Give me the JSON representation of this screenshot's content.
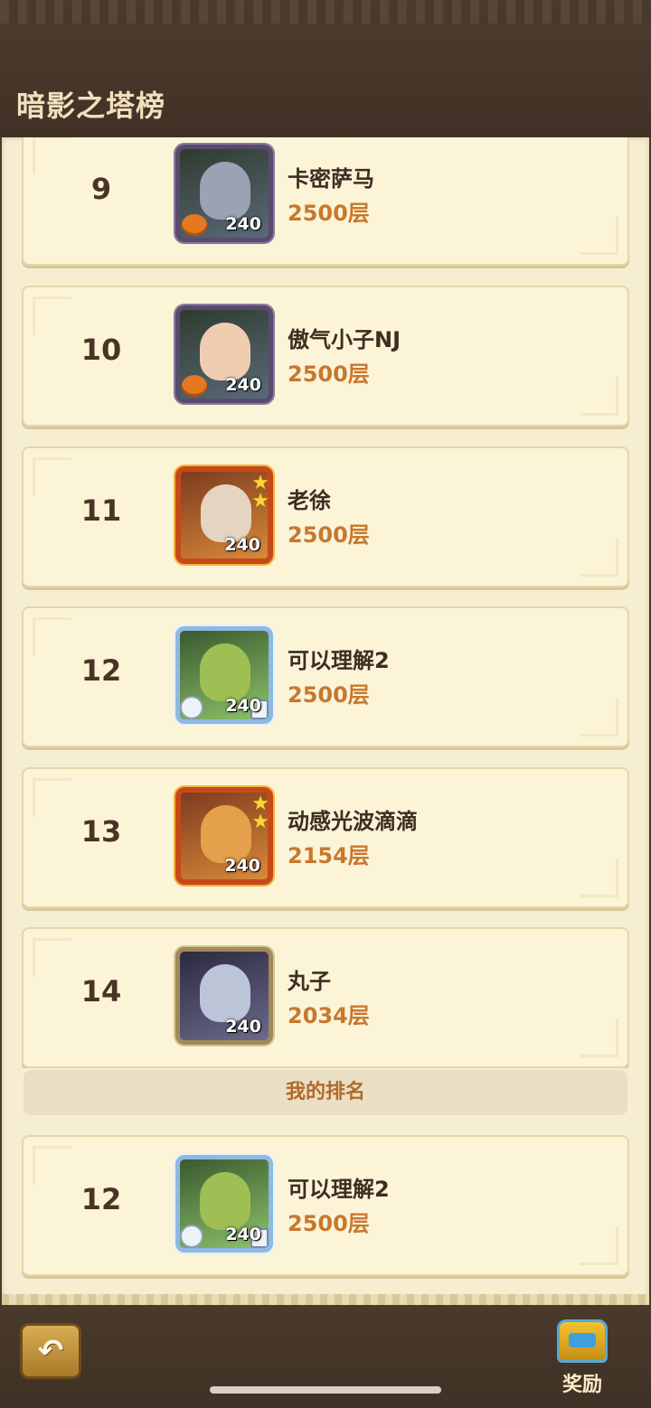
{
  "header": {
    "title": "暗影之塔榜"
  },
  "rankings": [
    {
      "rank": "9",
      "name": "卡密萨马",
      "floor": "2500层",
      "level": "240"
    },
    {
      "rank": "10",
      "name": "傲气小子NJ",
      "floor": "2500层",
      "level": "240"
    },
    {
      "rank": "11",
      "name": "老徐",
      "floor": "2500层",
      "level": "240"
    },
    {
      "rank": "12",
      "name": "可以理解2",
      "floor": "2500层",
      "level": "240"
    },
    {
      "rank": "13",
      "name": "动感光波滴滴",
      "floor": "2154层",
      "level": "240"
    },
    {
      "rank": "14",
      "name": "丸子",
      "floor": "2034层",
      "level": "240"
    }
  ],
  "my_rank": {
    "header": "我的排名",
    "rank": "12",
    "name": "可以理解2",
    "floor": "2500层",
    "level": "240"
  },
  "bottom_bar": {
    "reward_label": "奖励"
  },
  "icons": {
    "back": "back-arrow-icon",
    "reward": "treasure-chest-icon",
    "pumpkin": "pumpkin-icon",
    "star": "star-icon"
  },
  "colors": {
    "rank_text": "#4a3426",
    "floor_text": "#c7782e",
    "panel_bg": "#f6eed1",
    "top_bar": "#4a3a2c"
  }
}
